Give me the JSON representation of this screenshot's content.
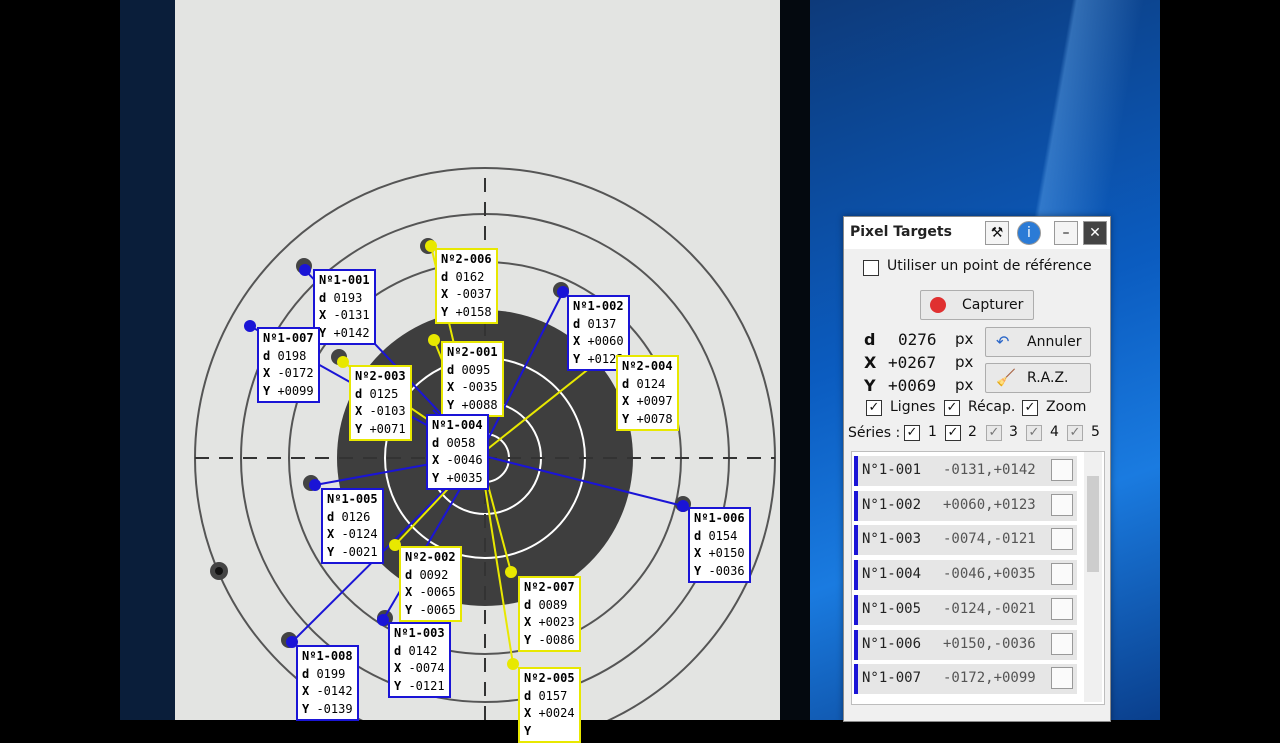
{
  "panel": {
    "title": "Pixel Targets",
    "ref_point_label": "Utiliser un point de référence",
    "capture_label": "Capturer",
    "d_label": "d",
    "d_value": "0276",
    "d_unit": "px",
    "x_label": "X",
    "x_value": "+0267",
    "x_unit": "px",
    "y_label": "Y",
    "y_value": "+0069",
    "y_unit": "px",
    "undo_label": "Annuler",
    "reset_label": "R.A.Z.",
    "opt_lines": "Lignes",
    "opt_recap": "Récap.",
    "opt_zoom": "Zoom",
    "series_label": "Séries :",
    "series": [
      "1",
      "2",
      "3",
      "4",
      "5"
    ],
    "rows": [
      {
        "id": "N°1-001",
        "val": "-0131,+0142"
      },
      {
        "id": "N°1-002",
        "val": "+0060,+0123"
      },
      {
        "id": "N°1-003",
        "val": "-0074,-0121"
      },
      {
        "id": "N°1-004",
        "val": "-0046,+0035"
      },
      {
        "id": "N°1-005",
        "val": "-0124,-0021"
      },
      {
        "id": "N°1-006",
        "val": "+0150,-0036"
      },
      {
        "id": "N°1-007",
        "val": "-0172,+0099"
      }
    ]
  },
  "labels": [
    {
      "no": "Nº1-001",
      "d": "0193",
      "x": "-0131",
      "y": "+0142",
      "c": "b"
    },
    {
      "no": "Nº1-007",
      "d": "0198",
      "x": "-0172",
      "y": "+0099",
      "c": "b"
    },
    {
      "no": "Nº2-006",
      "d": "0162",
      "x": "-0037",
      "y": "+0158",
      "c": "y"
    },
    {
      "no": "Nº1-002",
      "d": "0137",
      "x": "+0060",
      "y": "+0123",
      "c": "b"
    },
    {
      "no": "Nº2-001",
      "d": "0095",
      "x": "-0035",
      "y": "+0088",
      "c": "y"
    },
    {
      "no": "Nº2-004",
      "d": "0124",
      "x": "+0097",
      "y": "+0078",
      "c": "y"
    },
    {
      "no": "Nº2-003",
      "d": "0125",
      "x": "-0103",
      "y": "+0071",
      "c": "y"
    },
    {
      "no": "Nº1-004",
      "d": "0058",
      "x": "-0046",
      "y": "+0035",
      "c": "b"
    },
    {
      "no": "Nº1-005",
      "d": "0126",
      "x": "-0124",
      "y": "-0021",
      "c": "b"
    },
    {
      "no": "Nº1-006",
      "d": "0154",
      "x": "+0150",
      "y": "-0036",
      "c": "b"
    },
    {
      "no": "Nº2-002",
      "d": "0092",
      "x": "-0065",
      "y": "-0065",
      "c": "y"
    },
    {
      "no": "Nº2-007",
      "d": "0089",
      "x": "+0023",
      "y": "-0086",
      "c": "y"
    },
    {
      "no": "Nº1-003",
      "d": "0142",
      "x": "-0074",
      "y": "-0121",
      "c": "b"
    },
    {
      "no": "Nº1-008",
      "d": "0199",
      "x": "-0142",
      "y": "-0139",
      "c": "b"
    },
    {
      "no": "Nº2-005",
      "d": "0157",
      "x": "+0024",
      "y": "",
      "c": "y"
    }
  ],
  "colors": {
    "series1": "#1a14d6",
    "series2": "#e8e800",
    "accent": "#0a5cc0"
  }
}
